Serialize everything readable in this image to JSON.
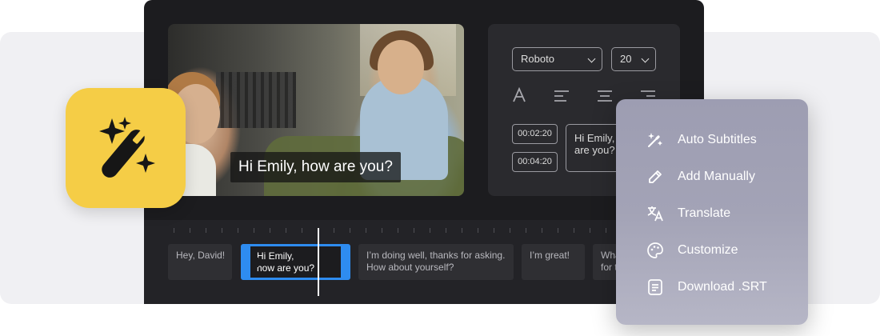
{
  "video": {
    "caption": "Hi Emily, how are you?"
  },
  "style_panel": {
    "font_family": "Roboto",
    "font_size": "20",
    "subtitle_rows": [
      {
        "time": "00:02:20",
        "text": "Hi Emily, are you?"
      },
      {
        "time": "00:04:20",
        "text": ""
      }
    ],
    "text_box_line1": "Hi Emily,",
    "text_box_line2": "are you?"
  },
  "timeline": {
    "clips": [
      {
        "line1": "Hey, David!",
        "line2": ""
      },
      {
        "line1": "Hi Emily,",
        "line2": "how are you?"
      },
      {
        "line1": "I’m doing well, thanks for asking.",
        "line2": "How about yourself?"
      },
      {
        "line1": "I’m great!",
        "line2": ""
      },
      {
        "line1": "Wha",
        "line2": "for t"
      }
    ]
  },
  "menu": {
    "items": [
      {
        "label": "Auto Subtitles",
        "icon": "magic-wand-icon"
      },
      {
        "label": "Add Manually",
        "icon": "pencil-icon"
      },
      {
        "label": "Translate",
        "icon": "translate-icon"
      },
      {
        "label": "Customize",
        "icon": "palette-icon"
      },
      {
        "label": "Download .SRT",
        "icon": "document-icon"
      }
    ]
  },
  "colors": {
    "accent": "#2e8cf0",
    "magic_tile": "#f5cd46",
    "editor_bg": "#1c1c1f"
  }
}
